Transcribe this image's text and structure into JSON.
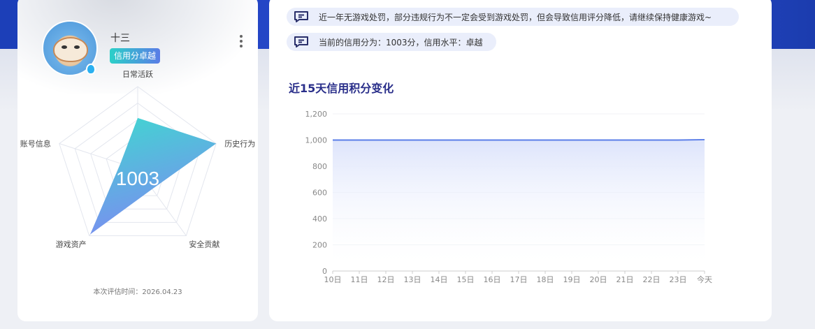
{
  "profile": {
    "name": "十三",
    "credit_badge": "信用分卓越",
    "eval_time": "本次评估时间：2026.04.23"
  },
  "radar": {
    "score": "1003",
    "axes": [
      {
        "label": "日常活跃",
        "value": 0.62
      },
      {
        "label": "历史行为",
        "value": 1.0
      },
      {
        "label": "安全贡献",
        "value": 0.3
      },
      {
        "label": "游戏资产",
        "value": 0.98
      },
      {
        "label": "账号信息",
        "value": 0.22
      }
    ],
    "colors": {
      "start": "#3fd8d0",
      "end": "#7a8ef0",
      "grid": "#e3e6ee"
    }
  },
  "notices": [
    {
      "text": "近一年无游戏处罚，部分违规行为不一定会受到游戏处罚，但会导致信用评分降低，请继续保持健康游戏~"
    },
    {
      "text": "当前的信用分为：1003分，信用水平：卓越"
    }
  ],
  "chart_title": "近15天信用积分变化",
  "chart_data": {
    "type": "area",
    "categories": [
      "10日",
      "11日",
      "12日",
      "13日",
      "14日",
      "15日",
      "16日",
      "17日",
      "18日",
      "19日",
      "20日",
      "21日",
      "22日",
      "23日",
      "今天"
    ],
    "values": [
      1000,
      1000,
      1000,
      1000,
      1000,
      1000,
      1000,
      1000,
      1000,
      1000,
      1000,
      1000,
      1000,
      1000,
      1003
    ],
    "yticks": [
      "0",
      "200",
      "400",
      "600",
      "800",
      "1,000",
      "1,200"
    ],
    "ylim": [
      0,
      1200
    ],
    "title": "",
    "xlabel": "",
    "ylabel": "",
    "line_color": "#5b7ee8",
    "fill_color": "#dde4fb"
  },
  "icons": {
    "more": "more-vertical-icon",
    "message": "message-bubble-icon",
    "qq": "qq-badge-icon"
  }
}
